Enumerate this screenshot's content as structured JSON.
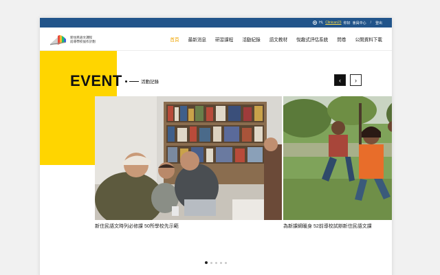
{
  "topbar": {
    "greeting": "Hi,",
    "username": "Clinican23",
    "greeting_suffix": "你好",
    "member_center": "會員中心",
    "separator": "/",
    "logout": "登出"
  },
  "logo": {
    "line1": "新住民語文課程",
    "line2": "前導學校協作計劃"
  },
  "nav": {
    "items": [
      {
        "label": "首頁",
        "active": true
      },
      {
        "label": "最新消息"
      },
      {
        "label": "研習課程"
      },
      {
        "label": "活動紀錄"
      },
      {
        "label": "語文教材"
      },
      {
        "label": "悅趣式評估系統"
      },
      {
        "label": "問卷"
      },
      {
        "label": "公開資料下載"
      }
    ]
  },
  "section": {
    "title": "EVENT",
    "subtitle": "活動記錄"
  },
  "carousel": {
    "prev_symbol": "‹",
    "next_symbol": "›",
    "cards": [
      {
        "caption": "新住民語文時列必修課 50所學校先示範"
      },
      {
        "caption": "為新課綱暖身 52前導校試辦新住民語文課"
      }
    ],
    "dots": 5,
    "active_dot": 0
  },
  "colors": {
    "topbar": "#21548a",
    "accent": "#ffd500",
    "active_nav": "#f0a500"
  }
}
